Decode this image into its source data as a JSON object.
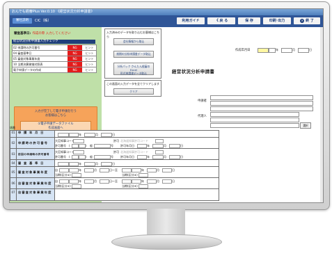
{
  "window": {
    "title": "おんでも経審Plus Ver.0.10 《経営状況分析申請書》"
  },
  "toolbar": {
    "tab": "審社説明",
    "company": "CIC（株）",
    "guide": "利用ガイド",
    "back": "《 戻 る",
    "save": "保 存",
    "print": "印刷･出力",
    "exit": "終 了",
    "exit_icon": "close-icon"
  },
  "left": {
    "base_date_label": "審査基準日:",
    "base_date_note": "作成の際 入力してください",
    "check_title": "経営状況分析申請書入力チェック",
    "checks": [
      {
        "label": "02 申請時の許可番号",
        "status": "NG",
        "hint": "ヒント"
      },
      {
        "label": "04 審査基準日",
        "status": "NG",
        "hint": "ヒント"
      },
      {
        "label": "05 審査対象事業年度",
        "status": "NG",
        "hint": "ヒント"
      },
      {
        "label": "10 当期決算貸借対照表",
        "status": "NG",
        "hint": "ヒント"
      },
      {
        "label": "電子申請データの作成",
        "status": "NG",
        "hint": "ヒント"
      }
    ],
    "e_apply_caption": "入力が完了して電子申請を行う\nお客様はこちら",
    "btn_create": "①電子申請データファイル\n作成画面へ",
    "btn_submit": "②経営状況分析申請書はこちら\n（CIICマイページログイン）"
  },
  "mid": {
    "import_caption": "入力済みのデータを取り込むお客様はこちら",
    "btn_company": "会社情報から取込",
    "btn_prev": "前期の分析申請書データ取込",
    "btn_excel": "分析パック かんたん経審のExcel\n形式申請書データ取込",
    "clear_caption": "この画面の入力データを全てクリアします",
    "btn_clear": "クリア"
  },
  "doc": {
    "created_label": "作成年月日",
    "year": "年",
    "month": "月",
    "day": "日",
    "title": "経営状況分析申請書",
    "applicant_label": "申請者",
    "agent_label": "代理人",
    "select_btn": "選択",
    "table_header": "項番",
    "rows": [
      {
        "num": "01",
        "name": "申 請 年 月 日"
      },
      {
        "num": "02",
        "name": "申請時の許可番号"
      },
      {
        "num": "03",
        "name": "前回の申請時の許可番号"
      },
      {
        "num": "04",
        "name": "審 査 基 準 日"
      },
      {
        "num": "05",
        "name": "審査対象事業年度"
      },
      {
        "num": "06",
        "name": "自審査対象事業年度"
      },
      {
        "num": "07",
        "name": "自審査対象事業年度"
      }
    ],
    "permit_minister": "大臣知事コード",
    "permit_no": "許可番号",
    "permit_label": "許可",
    "permit_gray": "北海道知事許可コード",
    "ippan": "般",
    "gou": "号",
    "permit_date": "許可年月日",
    "from": "自",
    "to": "日〜至",
    "cls": "当期(区分①)",
    "cls2": "当期(区分②)",
    "paren_l": "(",
    "paren_r": ")"
  }
}
